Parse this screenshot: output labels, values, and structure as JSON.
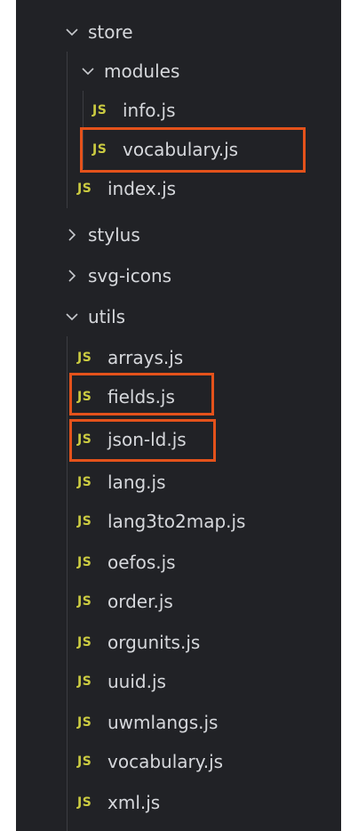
{
  "tree": {
    "js_badge": "JS",
    "store": {
      "label": "store",
      "state": "expanded"
    },
    "modules": {
      "label": "modules",
      "state": "expanded"
    },
    "modules_files": [
      "info.js",
      "vocabulary.js"
    ],
    "store_index": "index.js",
    "stylus": {
      "label": "stylus",
      "state": "collapsed"
    },
    "svg_icons": {
      "label": "svg-icons",
      "state": "collapsed"
    },
    "utils": {
      "label": "utils",
      "state": "expanded"
    },
    "utils_files": [
      "arrays.js",
      "fields.js",
      "json-ld.js",
      "lang.js",
      "lang3to2map.js",
      "oefos.js",
      "order.js",
      "orgunits.js",
      "uuid.js",
      "uwmlangs.js",
      "vocabulary.js",
      "xml.js"
    ]
  },
  "colors": {
    "background": "#212226",
    "text": "#d6d8dc",
    "js_icon": "#cbcb41",
    "highlight_box": "#e4521b"
  },
  "icons": {
    "expanded": "chevron-down-icon",
    "collapsed": "chevron-right-icon",
    "file": "javascript-file-icon"
  }
}
